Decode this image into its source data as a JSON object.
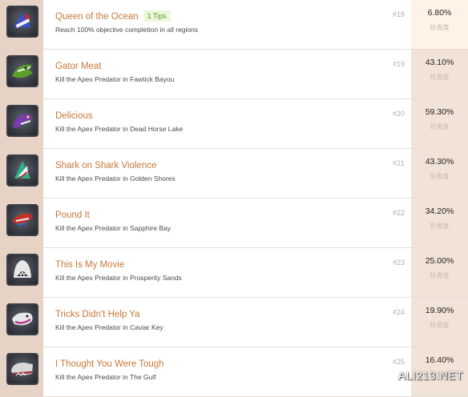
{
  "achievements": [
    {
      "title": "Queen of the Ocean",
      "tip": "1 Tips",
      "desc": "Reach 100% objective completion in all regions",
      "rank": "#18",
      "percent": "6.80%",
      "rarity": "珍贵度",
      "icon": "queen-emblem-icon",
      "accent": "#3a4fd0"
    },
    {
      "title": "Gator Meat",
      "tip": "",
      "desc": "Kill the Apex Predator in Fawtick Bayou",
      "rank": "#19",
      "percent": "43.10%",
      "rarity": "珍贵度",
      "icon": "gator-icon",
      "accent": "#5aa02a"
    },
    {
      "title": "Delicious",
      "tip": "",
      "desc": "Kill the Apex Predator in Dead Horse Lake",
      "rank": "#20",
      "percent": "59.30%",
      "rarity": "珍贵度",
      "icon": "eel-icon",
      "accent": "#7a3bb0"
    },
    {
      "title": "Shark on Shark Violence",
      "tip": "",
      "desc": "Kill the Apex Predator in Golden Shores",
      "rank": "#21",
      "percent": "43.30%",
      "rarity": "珍贵度",
      "icon": "shark-fin-icon",
      "accent": "#2bb08a"
    },
    {
      "title": "Pound It",
      "tip": "",
      "desc": "Kill the Apex Predator in Sapphire Bay",
      "rank": "#22",
      "percent": "34.20%",
      "rarity": "珍贵度",
      "icon": "red-shark-icon",
      "accent": "#c0332a"
    },
    {
      "title": "This Is My Movie",
      "tip": "",
      "desc": "Kill the Apex Predator in Prosperity Sands",
      "rank": "#23",
      "percent": "25.00%",
      "rarity": "珍贵度",
      "icon": "great-white-jaws-icon",
      "accent": "#e8e8e8"
    },
    {
      "title": "Tricks Didn't Help Ya",
      "tip": "",
      "desc": "Kill the Apex Predator in Caviar Key",
      "rank": "#24",
      "percent": "19.90%",
      "rarity": "珍贵度",
      "icon": "whale-icon",
      "accent": "#b03a8a"
    },
    {
      "title": "I Thought You Were Tough",
      "tip": "",
      "desc": "Kill the Apex Predator in The Gulf",
      "rank": "#25",
      "percent": "16.40%",
      "rarity": "珍贵度",
      "icon": "sperm-whale-icon",
      "accent": "#a03030"
    }
  ],
  "watermark": "ALI213.NET"
}
